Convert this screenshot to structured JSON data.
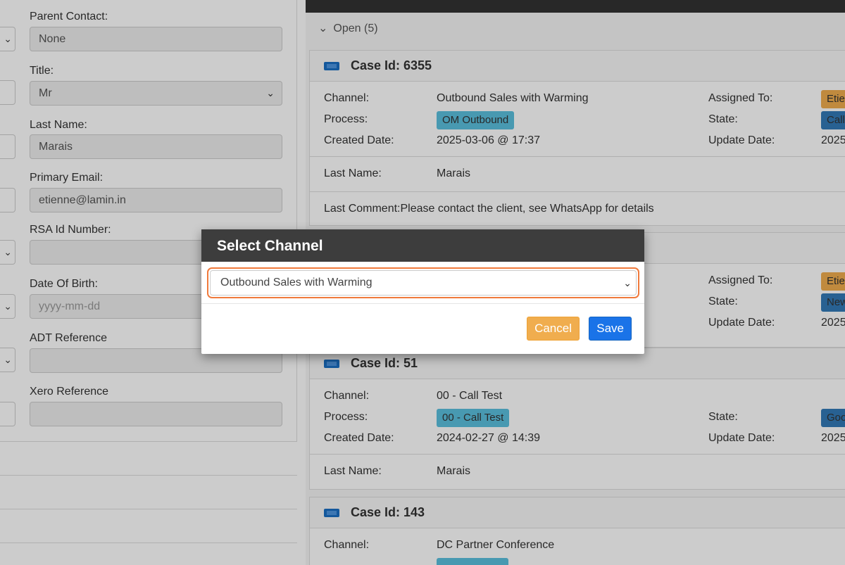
{
  "left_form": {
    "parent_contact": {
      "label": "Parent Contact:",
      "value": "None"
    },
    "title": {
      "label": "Title:",
      "value": "Mr"
    },
    "last_name": {
      "label": "Last Name:",
      "value": "Marais"
    },
    "primary_email": {
      "label": "Primary Email:",
      "value": "etienne@lamin.in"
    },
    "rsa_id": {
      "label": "RSA Id Number:",
      "value": ""
    },
    "dob": {
      "label": "Date Of Birth:",
      "placeholder": "yyyy-mm-dd"
    },
    "adt_reference": {
      "label": "ADT Reference",
      "value": ""
    },
    "xero_reference": {
      "label": "Xero Reference",
      "value": ""
    }
  },
  "cases": {
    "open_header": "Open (5)",
    "items": [
      {
        "title": "Case Id: 6355",
        "channel_label": "Channel:",
        "channel": "Outbound Sales with Warming",
        "process_label": "Process:",
        "process": "OM Outbound",
        "created_label": "Created Date:",
        "created": "2025-03-06 @ 17:37",
        "assigned_label": "Assigned To:",
        "assigned": "Etie",
        "state_label": "State:",
        "state": "Call",
        "update_label": "Update Date:",
        "update": "2025",
        "last_name_label": "Last Name:",
        "last_name": "Marais",
        "comment": "Last Comment:Please contact the client, see WhatsApp for details"
      },
      {
        "assigned_label": "Assigned To:",
        "assigned": "Etie",
        "state_label": "State:",
        "state": "New",
        "update_label": "Update Date:",
        "update": "2025"
      },
      {
        "title": "Case Id: 51",
        "channel_label": "Channel:",
        "channel": "00 - Call Test",
        "process_label": "Process:",
        "process": "00 - Call Test",
        "created_label": "Created Date:",
        "created": "2024-02-27 @ 14:39",
        "state_label": "State:",
        "state": "Goo",
        "update_label": "Update Date:",
        "update": "2025",
        "last_name_label": "Last Name:",
        "last_name": "Marais"
      },
      {
        "title": "Case Id: 143",
        "channel_label": "Channel:",
        "channel": "DC Partner Conference"
      }
    ]
  },
  "modal": {
    "title": "Select Channel",
    "selected_channel": "Outbound Sales with Warming",
    "cancel_label": "Cancel",
    "save_label": "Save"
  },
  "icons": {
    "chevron": "chevron-down-icon",
    "ticket": "ticket-icon"
  },
  "colors": {
    "modal_header": "#3d3d3d",
    "focus_ring": "#f07a3c",
    "save": "#1a73e8",
    "cancel": "#f0ad4e",
    "process_pill": "#5bc0de"
  }
}
